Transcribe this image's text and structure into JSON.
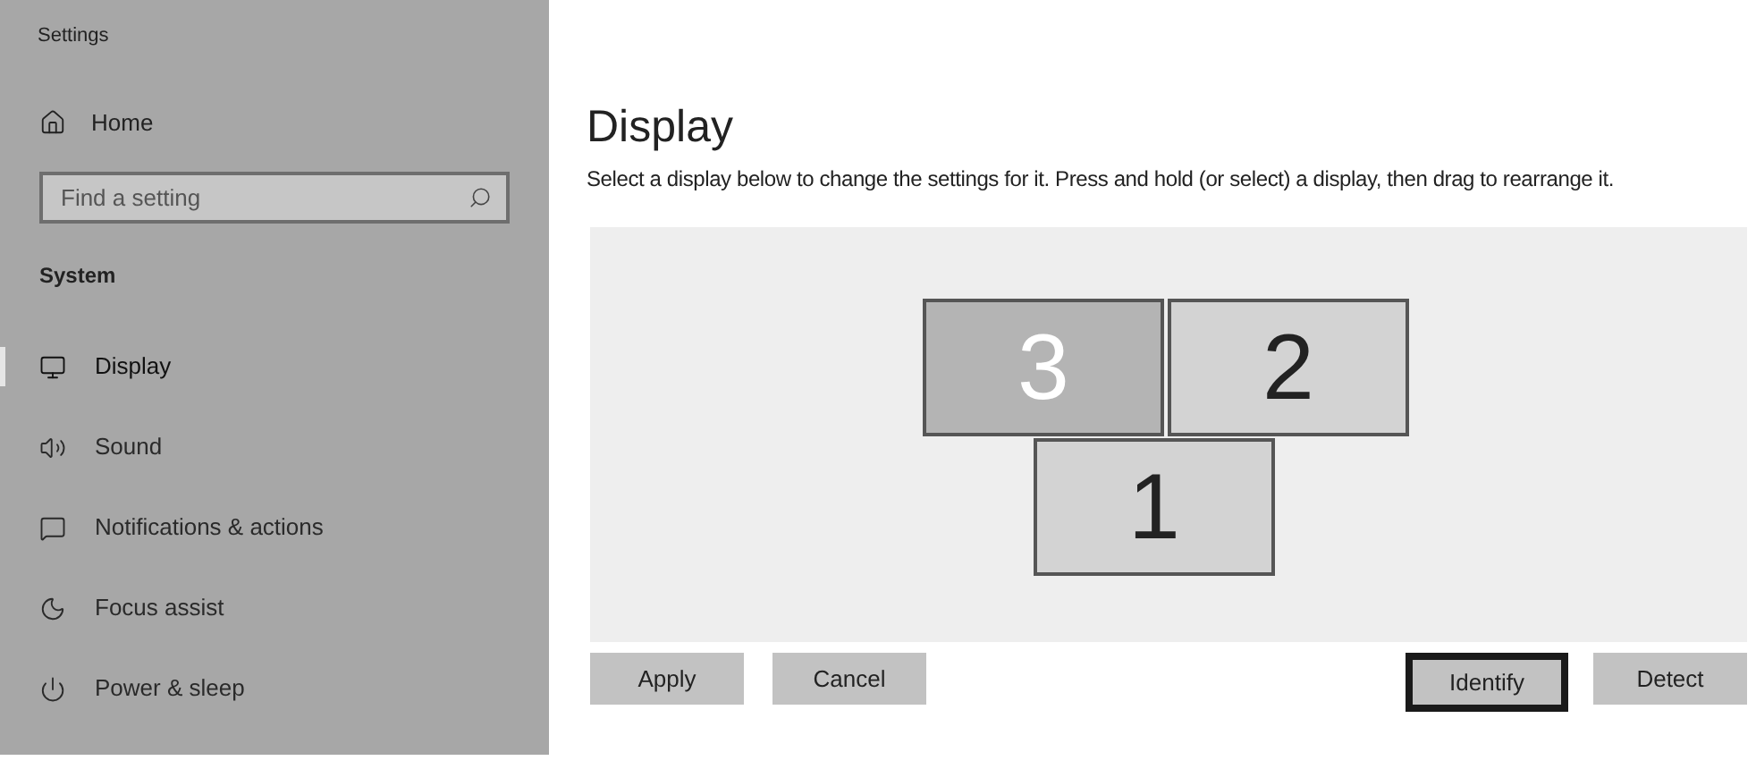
{
  "window": {
    "title": "Settings"
  },
  "sidebar": {
    "home": {
      "label": "Home"
    },
    "search": {
      "placeholder": "Find a setting"
    },
    "section": "System",
    "items": [
      {
        "label": "Display",
        "selected": true
      },
      {
        "label": "Sound",
        "selected": false
      },
      {
        "label": "Notifications & actions",
        "selected": false
      },
      {
        "label": "Focus assist",
        "selected": false
      },
      {
        "label": "Power & sleep",
        "selected": false
      }
    ]
  },
  "main": {
    "title": "Display",
    "description": "Select a display below to change the settings for it. Press and hold (or select) a display, then drag to rearrange it.",
    "monitors": [
      {
        "label": "3",
        "selected": true
      },
      {
        "label": "2",
        "selected": false
      },
      {
        "label": "1",
        "selected": false
      }
    ],
    "buttons": [
      {
        "label": "Apply",
        "focused": false
      },
      {
        "label": "Cancel",
        "focused": false
      },
      {
        "label": "Identify",
        "focused": true
      },
      {
        "label": "Detect",
        "focused": false
      }
    ]
  }
}
